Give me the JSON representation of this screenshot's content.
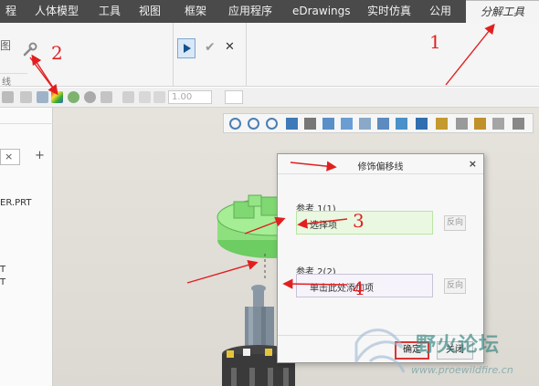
{
  "tabs": [
    {
      "label": "程",
      "active": false
    },
    {
      "label": "人体模型",
      "active": false
    },
    {
      "label": "工具",
      "active": false
    },
    {
      "label": "视图",
      "active": false
    },
    {
      "label": "框架",
      "active": false
    },
    {
      "label": "应用程序",
      "active": false
    },
    {
      "label": "eDrawings",
      "active": false
    },
    {
      "label": "实时仿真",
      "active": false
    },
    {
      "label": "公用",
      "active": false
    },
    {
      "label": "分解工具",
      "active": true
    }
  ],
  "ribbon": {
    "left_label": "作图",
    "group_footer": "线"
  },
  "toolbar2": {
    "value_field": "1.00"
  },
  "tree": {
    "items": [
      "ER.PRT",
      "T",
      "T"
    ]
  },
  "dialog": {
    "title": "修饰偏移线",
    "close": "×",
    "ref1_label": "参考 1(1)",
    "ref1_value": "选择项",
    "ref2_label": "参考 2(2)",
    "ref2_value": "单击此处添加项",
    "reverse_label": "反向",
    "ok_label": "确定",
    "cancel_label": "关闭"
  },
  "annotations": [
    "1",
    "2",
    "3",
    "4"
  ],
  "watermark": {
    "brand": "野火论坛",
    "url": "www.proewildfire.cn"
  },
  "colors": {
    "tabbar": "#4a4a4a",
    "annotation": "#e02020",
    "model_green": "#8ee07e",
    "ref1_bg": "#eaf8e1",
    "ref2_bg": "#f6f3fb"
  }
}
